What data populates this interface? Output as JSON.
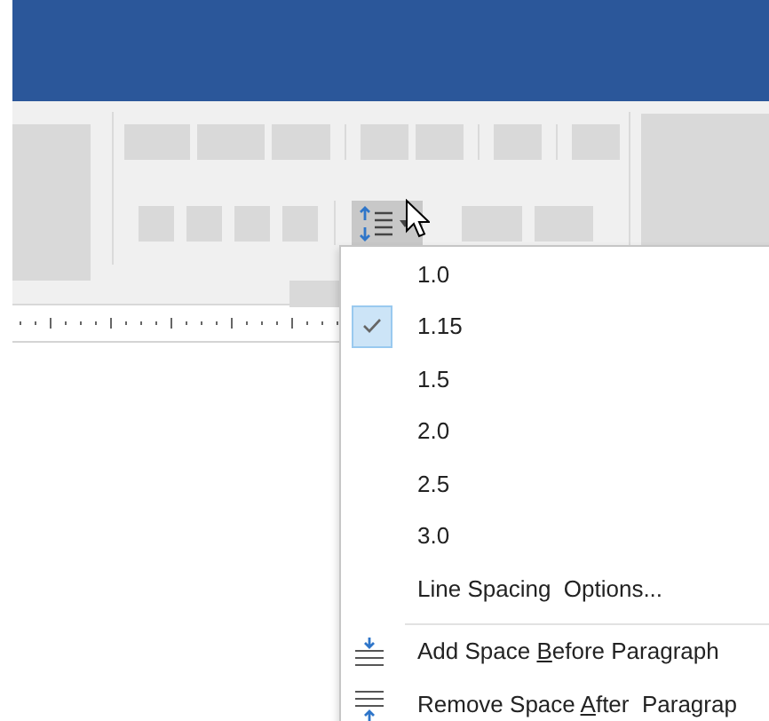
{
  "line_spacing_menu": {
    "options": [
      {
        "label": "1.0",
        "selected": false
      },
      {
        "label": "1.15",
        "selected": true
      },
      {
        "label": "1.5",
        "selected": false
      },
      {
        "label": "2.0",
        "selected": false
      },
      {
        "label": "2.5",
        "selected": false
      },
      {
        "label": "3.0",
        "selected": false
      }
    ],
    "more": {
      "label": "Line Spacing  Options..."
    },
    "actions": [
      {
        "kind": "add-before",
        "label_parts": [
          "Add Space ",
          "B",
          "efore Paragraph"
        ]
      },
      {
        "kind": "remove-after",
        "label_parts": [
          "Remove Space ",
          "A",
          "fter  Paragrap"
        ]
      }
    ]
  }
}
